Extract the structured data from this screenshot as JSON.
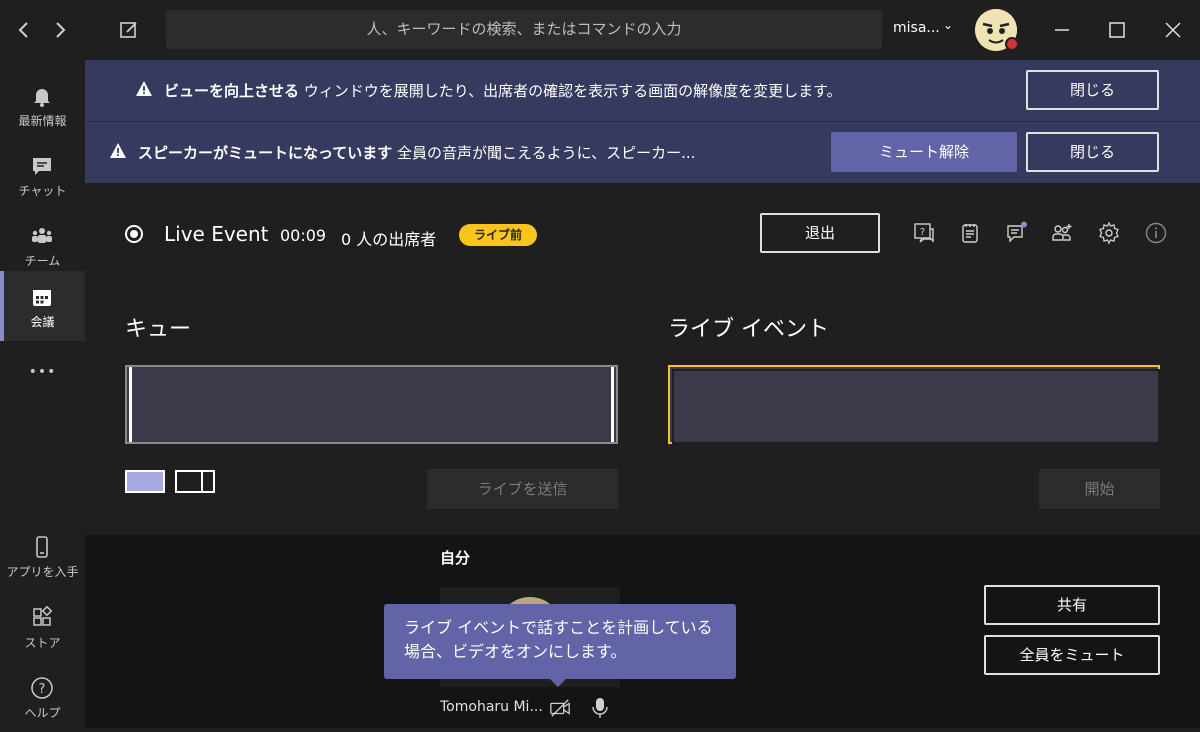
{
  "titlebar": {
    "back_icon": "chevron-left-icon",
    "forward_icon": "chevron-right-icon",
    "search_placeholder": "人、キーワードの検索、またはコマンドの入力",
    "user_name": "misa...",
    "user_chevron": "⌄"
  },
  "rail": {
    "items": [
      {
        "label": "最新情報",
        "icon": "bell-icon"
      },
      {
        "label": "チャット",
        "icon": "chat-icon"
      },
      {
        "label": "チーム",
        "icon": "teams-icon"
      },
      {
        "label": "会議",
        "icon": "calendar-icon"
      },
      {
        "label": "アプリを入手",
        "icon": "phone-icon"
      },
      {
        "label": "ストア",
        "icon": "store-icon"
      },
      {
        "label": "ヘルプ",
        "icon": "help-icon"
      }
    ],
    "more_label": "•••"
  },
  "banners": {
    "view": {
      "bold": "ビューを向上させる",
      "text": " ウィンドウを展開したり、出席者の確認を表示する画面の解像度を変更します。",
      "close_label": "閉じる"
    },
    "mute": {
      "bold": "スピーカーがミュートになっています",
      "text": " 全員の音声が聞こえるように、スピーカー...",
      "unmute_label": "ミュート解除",
      "close_label": "閉じる"
    }
  },
  "event": {
    "title": "Live Event",
    "time": "00:09",
    "attendees": "0 人の出席者",
    "badge": "ライブ前",
    "exit_label": "退出",
    "badge_color": "#f8c51c",
    "accent": "#6264a7"
  },
  "queue": {
    "title": "キュー",
    "send_label": "ライブを送信"
  },
  "live": {
    "title": "ライブ イベント",
    "start_label": "開始"
  },
  "bottom": {
    "self_label": "自分",
    "tooltip": "ライブ イベントで話すことを計画している場合、ビデオをオンにします。",
    "self_name": "Tomoharu Mi...",
    "share_label": "共有",
    "mute_all_label": "全員をミュート"
  }
}
